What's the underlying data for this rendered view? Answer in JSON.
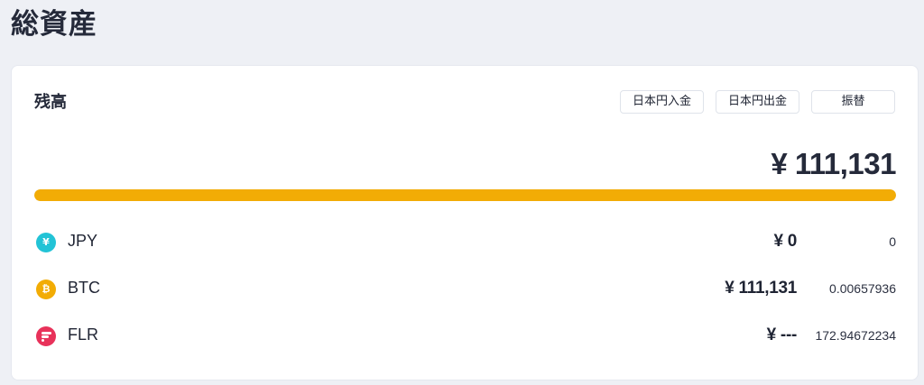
{
  "page": {
    "title": "総資産"
  },
  "balance": {
    "title": "残高",
    "buttons": {
      "deposit_label": "日本円入金",
      "withdraw_label": "日本円出金",
      "transfer_label": "振替"
    },
    "total": "¥ 111,131",
    "bar": {
      "fill_fraction": 1.0,
      "color": "#f2ac05"
    },
    "assets": [
      {
        "icon": "yen-icon",
        "icon_glyph": "¥",
        "color": "#22c3d6",
        "name": "JPY",
        "jpy_value": "¥ 0",
        "amount": "0"
      },
      {
        "icon": "bitcoin-icon",
        "icon_glyph": "₿",
        "color": "#f2ac05",
        "name": "BTC",
        "jpy_value": "¥ 111,131",
        "amount": "0.00657936"
      },
      {
        "icon": "flare-icon",
        "icon_glyph": "",
        "color": "#e8325a",
        "name": "FLR",
        "jpy_value": "¥ ---",
        "amount": "172.94672234"
      }
    ]
  }
}
